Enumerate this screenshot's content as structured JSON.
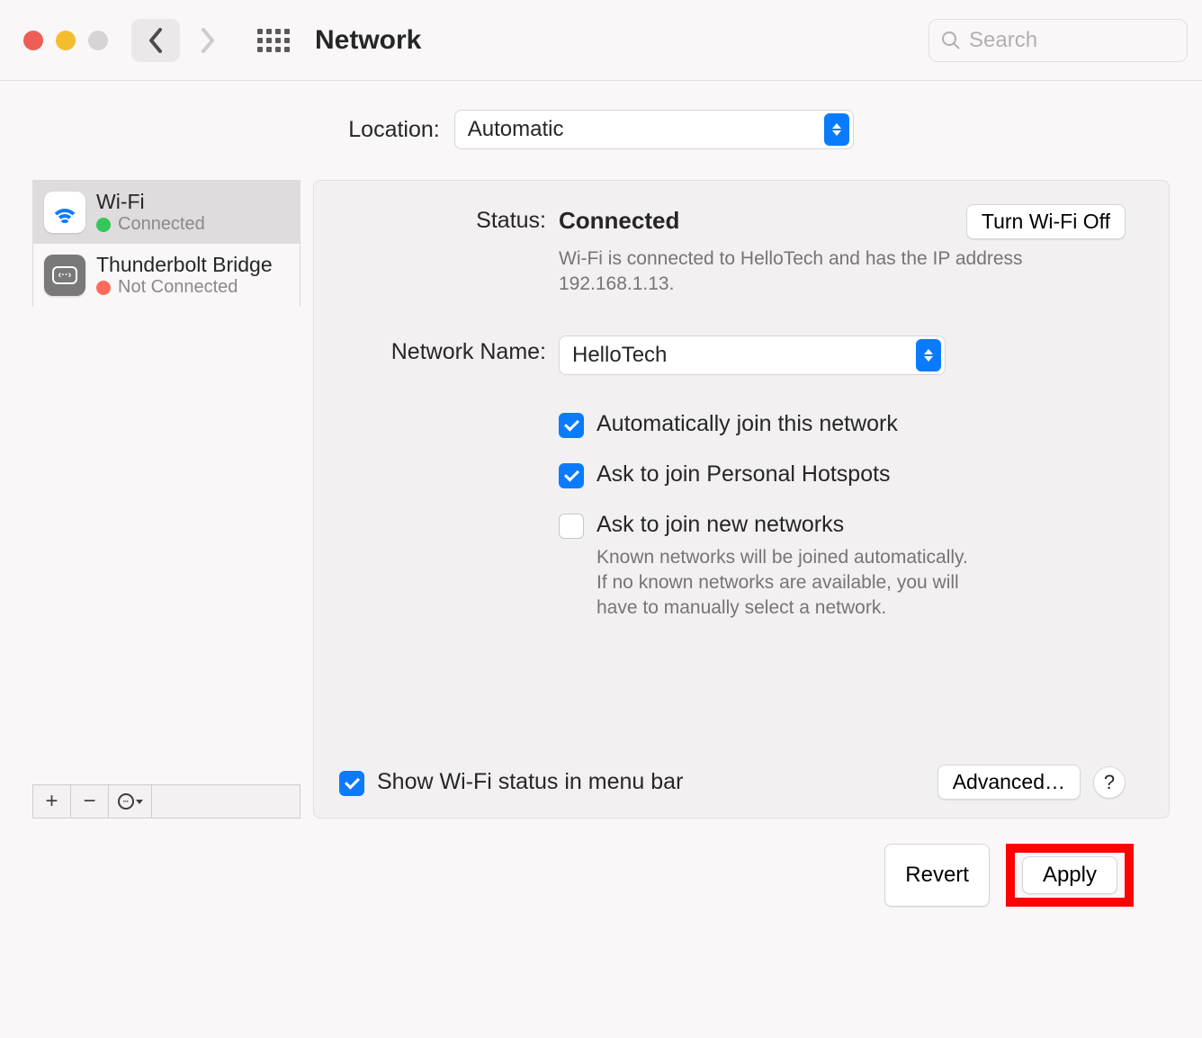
{
  "titlebar": {
    "title": "Network",
    "search_placeholder": "Search"
  },
  "location": {
    "label": "Location:",
    "selected": "Automatic"
  },
  "sidebar": {
    "services": [
      {
        "name": "Wi-Fi",
        "status": "Connected",
        "dot_color": "green",
        "selected": true
      },
      {
        "name": "Thunderbolt Bridge",
        "status": "Not Connected",
        "dot_color": "orange",
        "selected": false
      }
    ]
  },
  "detail": {
    "status_label": "Status:",
    "status_value": "Connected",
    "turn_off_label": "Turn Wi-Fi Off",
    "status_description": "Wi-Fi is connected to HelloTech and has the IP address 192.168.1.13.",
    "network_name_label": "Network Name:",
    "network_name_value": "HelloTech",
    "checkboxes": {
      "auto_join": {
        "label": "Automatically join this network",
        "checked": true
      },
      "personal_hotspots": {
        "label": "Ask to join Personal Hotspots",
        "checked": true
      },
      "new_networks": {
        "label": "Ask to join new networks",
        "description": "Known networks will be joined automatically. If no known networks are available, you will have to manually select a network.",
        "checked": false
      }
    },
    "show_status_label": "Show Wi-Fi status in menu bar",
    "advanced_label": "Advanced…",
    "help_label": "?"
  },
  "footer": {
    "revert_label": "Revert",
    "apply_label": "Apply"
  }
}
